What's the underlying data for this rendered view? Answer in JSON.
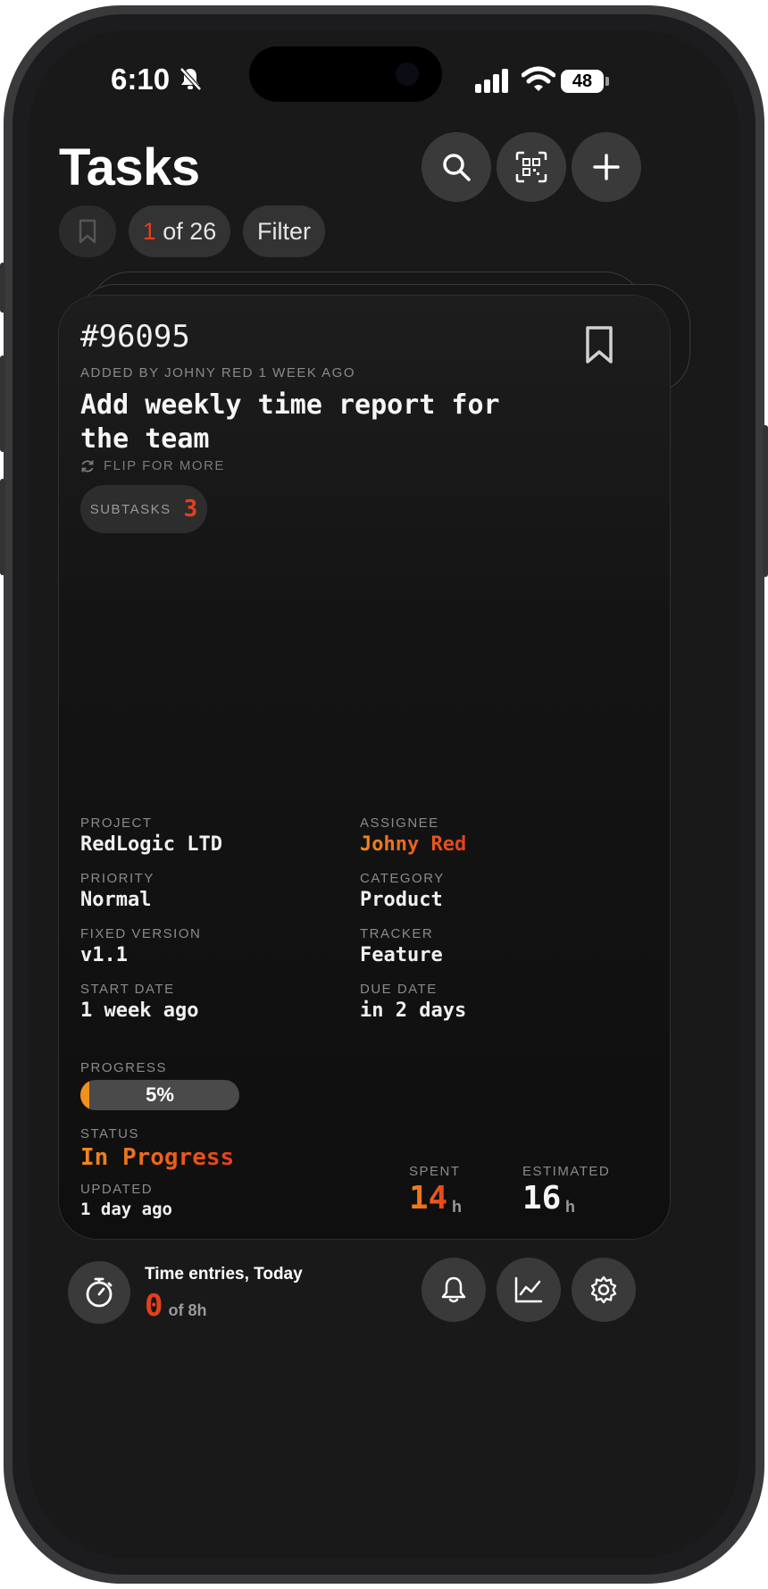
{
  "status_bar": {
    "time": "6:10",
    "battery": "48"
  },
  "header": {
    "title": "Tasks",
    "icons": [
      "search-icon",
      "qr-scan-icon",
      "plus-icon"
    ]
  },
  "toolbar": {
    "counter_current": "1",
    "counter_rest": " of 26",
    "filter_label": "Filter"
  },
  "task": {
    "id": "#96095",
    "meta": "ADDED BY JOHNY RED 1 WEEK AGO",
    "title": "Add weekly time report for the team",
    "flip_label": "FLIP FOR MORE",
    "subtasks_label": "SUBTASKS",
    "subtasks_count": "3",
    "fields": {
      "project_label": "PROJECT",
      "project": "RedLogic LTD",
      "assignee_label": "ASSIGNEE",
      "assignee": "Johny Red",
      "priority_label": "PRIORITY",
      "priority": "Normal",
      "category_label": "CATEGORY",
      "category": "Product",
      "fixed_version_label": "FIXED VERSION",
      "fixed_version": "v1.1",
      "tracker_label": "TRACKER",
      "tracker": "Feature",
      "start_date_label": "START DATE",
      "start_date": "1 week ago",
      "due_date_label": "DUE DATE",
      "due_date": "in 2 days"
    },
    "progress_label": "PROGRESS",
    "progress_text": "5%",
    "progress_fraction": 0.05,
    "status_label": "STATUS",
    "status": "In Progress",
    "updated_label": "UPDATED",
    "updated": "1 day ago",
    "spent_label": "SPENT",
    "spent": "14",
    "estimated_label": "ESTIMATED",
    "estimated": "16",
    "hours_unit": "h"
  },
  "bottom": {
    "entries_title": "Time entries, Today",
    "entries_value": "0",
    "entries_of": "of 8h",
    "icons": [
      "stopwatch-icon",
      "bell-icon",
      "chart-icon",
      "gear-icon"
    ]
  },
  "colors": {
    "accent_red": "#e3401e",
    "accent_orange": "#f0901e",
    "background": "#191919"
  }
}
